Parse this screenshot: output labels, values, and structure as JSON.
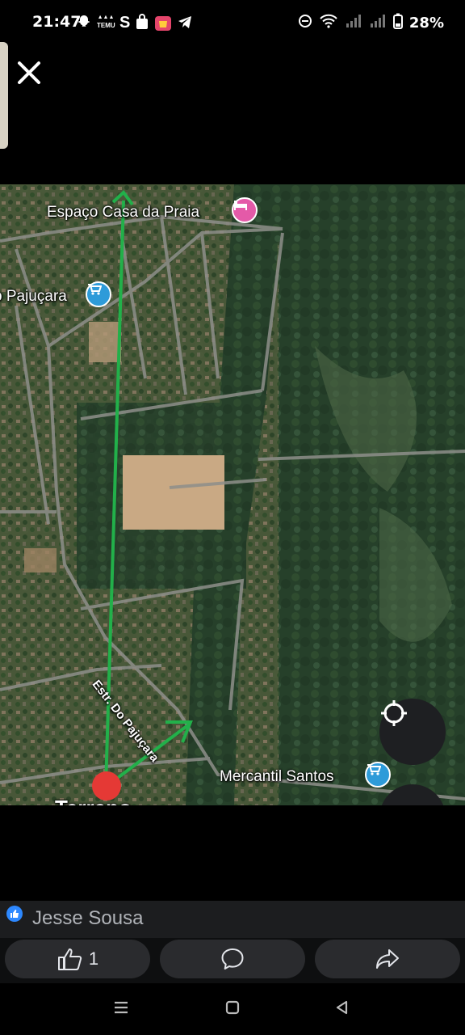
{
  "status": {
    "time": "21:47",
    "left_icons": [
      "snapchat-icon",
      "temu-icon",
      "shein-icon",
      "shopping-bag-icon",
      "shopee-icon",
      "telegram-icon"
    ],
    "temu_text": "TEMU",
    "shein_letter": "S",
    "right_icons": [
      "dnd-icon",
      "wifi-icon",
      "signal-icon",
      "signal-icon",
      "battery-icon"
    ],
    "battery": "28%"
  },
  "map": {
    "labels": {
      "top_place": "Espaço Casa da Praia",
      "left_place": "o Pajuçara",
      "road": "Estr. Do Pajuçara",
      "bottom_place": "Mercantil Santos",
      "cut_label": "Terreno"
    },
    "colors": {
      "arrow": "#22b04a",
      "pin_red": "#e53935",
      "shop_pin": "#2e9bd9",
      "hotel_pin": "#e45aa8"
    }
  },
  "post": {
    "author": "Jesse Sousa"
  },
  "actions": {
    "like_count": "1"
  }
}
